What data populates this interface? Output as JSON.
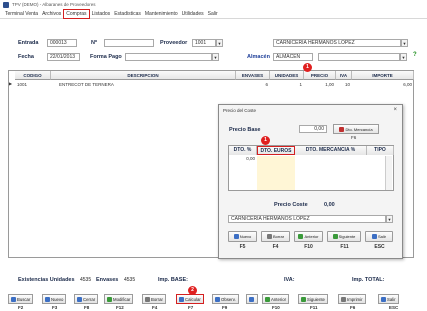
{
  "window": {
    "title": "TPV (DEMO) - Albaranes de Proveedores"
  },
  "menu": [
    "Terminal Venta",
    "Archivos",
    "Compras",
    "Listados",
    "Estadisticas",
    "Mantenimiento",
    "Utilidades",
    "Salir"
  ],
  "header": {
    "entrada_label": "Entrada",
    "entrada_value": "000013",
    "nf_label": "Nº",
    "nf_value": "",
    "proveedor_label": "Proveedor",
    "proveedor_code": "1001",
    "proveedor_name": "CARNICERIA HERMANOS LOPEZ",
    "fecha_label": "Fecha",
    "fecha_value": "22/01/2013",
    "forma_pago_label": "Forma Pago",
    "forma_pago_value": "",
    "almacen_label": "Almacén",
    "almacen_value": "ALMACEN",
    "extra_field": ""
  },
  "grid": {
    "columns": [
      "CODIGO",
      "DESCRIPCION",
      "ENVASES",
      "UNIDADES",
      "PRECIO",
      "IVA",
      "IMPORTE"
    ],
    "rows": [
      {
        "codigo": "1001",
        "descripcion": "ENTRECOT DE TERNERA",
        "envases": "6",
        "unidades": "1",
        "precio": "1,00",
        "iva": "10",
        "importe": "6,00"
      }
    ]
  },
  "badges": {
    "one": "1",
    "two": "2"
  },
  "modal": {
    "title": "Precio del Coste",
    "precio_base_label": "Precio Base",
    "precio_base_value": "0,00",
    "descuento_button": "Dto. Mercancía",
    "descuento_value": "F6",
    "columns": [
      "DTO. %",
      "DTO. EUROS",
      "DTO. MERCANCIA %",
      "TIPO"
    ],
    "first_cell": "0,00",
    "precio_coste_label": "Precio Coste",
    "precio_coste_value": "0,00",
    "supplier_name": "CARNICERIA HERMANOS LOPEZ",
    "buttons": [
      {
        "label": "Nuevo",
        "key": "F5"
      },
      {
        "label": "Borrar",
        "key": "F4"
      },
      {
        "label": "Anterior",
        "key": "F10"
      },
      {
        "label": "Siguiente",
        "key": "F11"
      },
      {
        "label": "Salir",
        "key": "ESC"
      }
    ]
  },
  "footer": {
    "existencias_label": "Existencias Unidades",
    "existencias_value": "4535",
    "envases_label": "Envases",
    "envases_value": "4535",
    "imp_base_label": "Imp. BASE:",
    "iva_label": "IVA:",
    "imp_total_label": "Imp. TOTAL:"
  },
  "toolbar": [
    {
      "label": "Buscar",
      "key": "F2"
    },
    {
      "label": "Nuevo",
      "key": "F3"
    },
    {
      "label": "Cerrar",
      "key": "F8"
    },
    {
      "label": "Modificar",
      "key": "F12"
    },
    {
      "label": "Borrar",
      "key": "F4"
    },
    {
      "label": "Calcular",
      "key": "F7"
    },
    {
      "label": "Observ.",
      "key": "F9"
    },
    {
      "label": "",
      "key": ""
    },
    {
      "label": "Anterior",
      "key": "F10"
    },
    {
      "label": "Siguiente",
      "key": "F11"
    },
    {
      "label": "Imprimir",
      "key": "F6"
    },
    {
      "label": "Salir",
      "key": "ESC"
    }
  ],
  "colors": {
    "accent": "#1e3f99",
    "badge": "#e02020",
    "highlight": "#d42020"
  }
}
